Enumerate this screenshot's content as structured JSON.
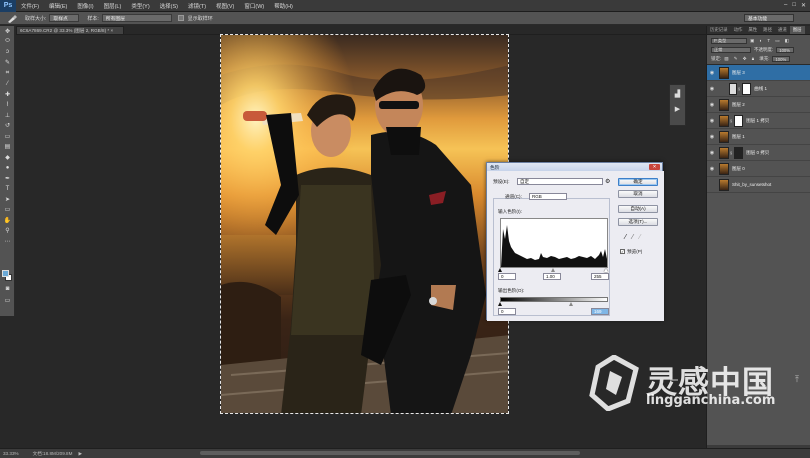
{
  "app": {
    "logo": "Ps",
    "menu": [
      "文件(F)",
      "编辑(E)",
      "图像(I)",
      "图层(L)",
      "类型(Y)",
      "选择(S)",
      "滤镜(T)",
      "视图(V)",
      "窗口(W)",
      "帮助(H)"
    ],
    "window_buttons": [
      "–",
      "□",
      "✕"
    ]
  },
  "options_bar": {
    "sample_size_label": "取样大小:",
    "sample_size_value": "取样点",
    "sample_label": "样本:",
    "sample_value": "所有图层",
    "show_ring_label": "显示取样环",
    "workspace": "基本功能"
  },
  "document": {
    "tab": "6C6A7869.CR2 @ 33.3% (图层 2, RGB/8) * ×"
  },
  "statusbar": {
    "zoom": "33.33%",
    "doc_size": "文档:18.8M/209.8M"
  },
  "panels": {
    "tabs": [
      "历史记录",
      "动作",
      "属性",
      "路径",
      "通道",
      "图层"
    ],
    "active_tab": "图层",
    "filter_label": "P 类型",
    "blend_mode": "正常",
    "opacity_label": "不透明度:",
    "opacity_value": "100%",
    "lock_label": "锁定:",
    "fill_label": "填充:",
    "fill_value": "100%",
    "layers": [
      {
        "name": "图层 3",
        "type": "image",
        "selected": true
      },
      {
        "name": "曲线 1",
        "type": "adjustment",
        "selected": false
      },
      {
        "name": "图层 2",
        "type": "image",
        "selected": false
      },
      {
        "name": "图层 1 拷贝",
        "type": "masked",
        "selected": false
      },
      {
        "name": "图层 1",
        "type": "image",
        "selected": false
      },
      {
        "name": "图层 0 拷贝",
        "type": "masked",
        "selected": false
      },
      {
        "name": "图层 0",
        "type": "image",
        "selected": false
      },
      {
        "name": "Shit_by_sunsetshot",
        "type": "image",
        "selected": false
      }
    ]
  },
  "levels_dialog": {
    "title": "色阶",
    "preset_label": "预设(E):",
    "preset_value": "自定",
    "channel_label": "通道(C):",
    "channel_value": "RGB",
    "input_label": "输入色阶(I):",
    "input_black": "0",
    "input_gamma": "1.00",
    "input_white": "255",
    "output_label": "输出色阶(O):",
    "output_black": "0",
    "output_white": "169",
    "buttons": {
      "ok": "确定",
      "cancel": "取消",
      "auto": "自动(A)",
      "options": "选项(T)..."
    },
    "preview_label": "预览(P)",
    "preview_checked": true
  },
  "watermark": {
    "cn": "灵感中国",
    "en": "lingganchina.com"
  }
}
